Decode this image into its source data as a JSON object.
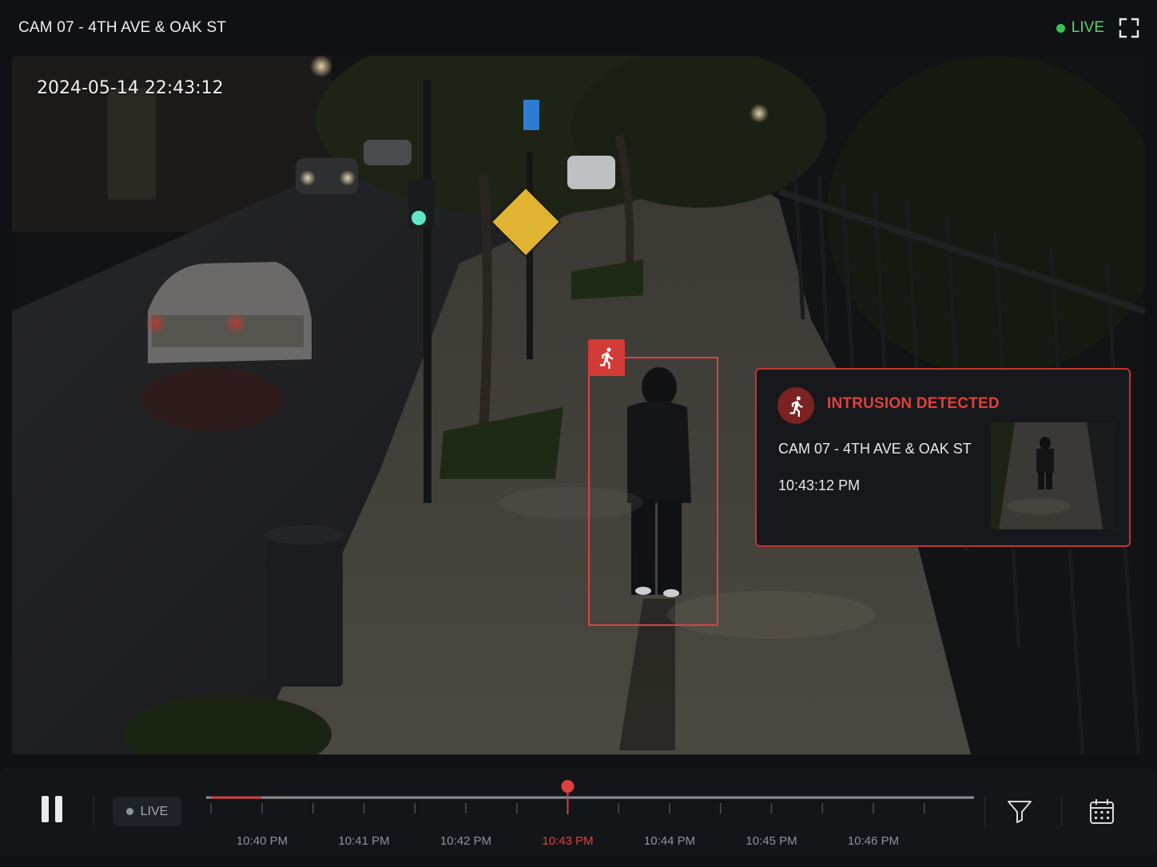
{
  "header": {
    "camera_title": "CAM 07 - 4TH AVE & OAK ST",
    "live_label": "LIVE"
  },
  "video": {
    "timestamp": "2024-05-14 22:43:12"
  },
  "alert": {
    "title": "INTRUSION DETECTED",
    "camera": "CAM 07 - 4TH AVE & OAK ST",
    "time": "10:43:12 PM"
  },
  "controls": {
    "live_label": "LIVE",
    "timeline": {
      "ticks": [
        "10:40 PM",
        "10:41 PM",
        "10:42 PM",
        "10:43 PM",
        "10:44 PM",
        "10:45 PM",
        "10:46 PM"
      ],
      "current": "10:43 PM",
      "playhead_minutes": 3.0,
      "event_range_minutes": [
        -0.5,
        0.0
      ]
    }
  },
  "colors": {
    "accent_red": "#d9423e",
    "live_green": "#39c25a"
  }
}
